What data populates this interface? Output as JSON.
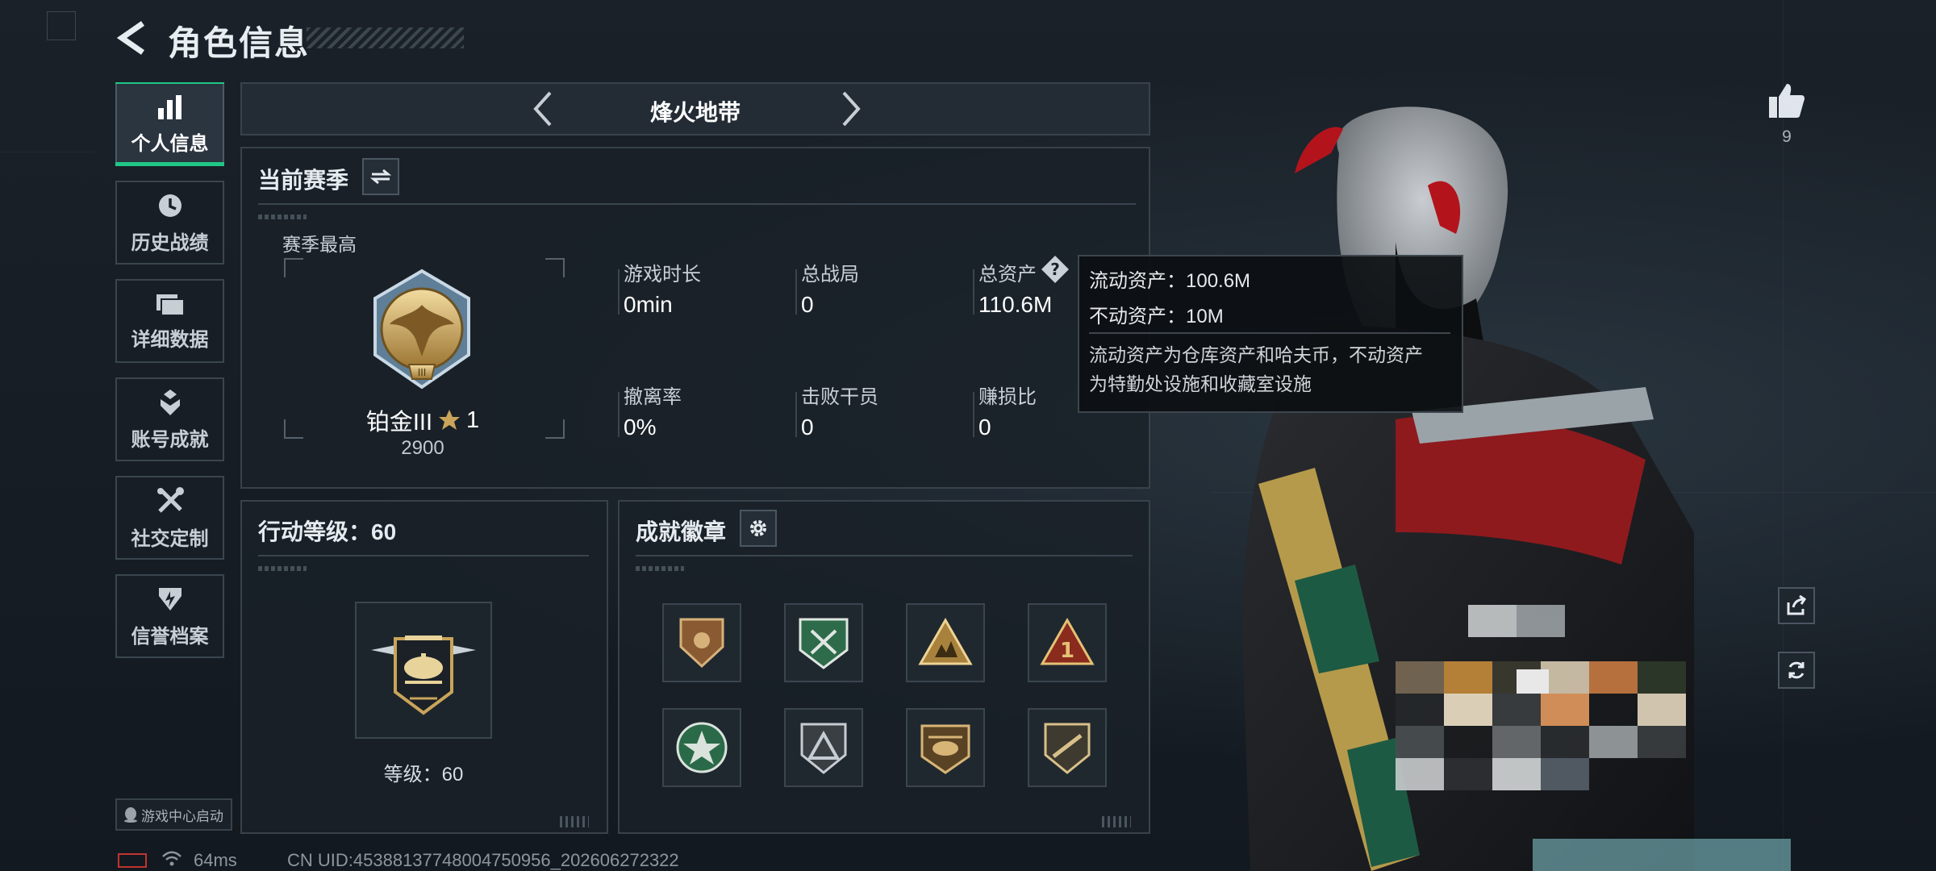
{
  "header": {
    "title": "角色信息"
  },
  "sidebar": {
    "items": [
      {
        "label": "个人信息",
        "icon": "bar-chart-icon",
        "active": true
      },
      {
        "label": "历史战绩",
        "icon": "history-clock-icon"
      },
      {
        "label": "详细数据",
        "icon": "folder-stack-icon"
      },
      {
        "label": "账号成就",
        "icon": "achievement-shield-icon"
      },
      {
        "label": "社交定制",
        "icon": "tools-icon"
      },
      {
        "label": "信誉档案",
        "icon": "reputation-badge-icon"
      }
    ],
    "launch_label": "游戏中心启动"
  },
  "mode": {
    "title": "烽火地带"
  },
  "season": {
    "title": "当前赛季",
    "best_label": "赛季最高",
    "rank_name": "铂金III",
    "rank_stars": "1",
    "rank_points": "2900",
    "stats": [
      {
        "label": "游戏时长",
        "value": "0min"
      },
      {
        "label": "总战局",
        "value": "0"
      },
      {
        "label": "总资产",
        "value": "110.6M"
      },
      {
        "label": "撤离率",
        "value": "0%"
      },
      {
        "label": "击败干员",
        "value": "0"
      },
      {
        "label": "赚损比",
        "value": "0"
      }
    ]
  },
  "tooltip": {
    "liquid": "流动资产：100.6M",
    "fixed": "不动资产：10M",
    "desc_line1": "流动资产为仓库资产和哈夫币，不动资产",
    "desc_line2": "为特勤处设施和收藏室设施"
  },
  "action_level": {
    "title": "行动等级：60",
    "level_label": "等级：60"
  },
  "achievements": {
    "title": "成就徽章"
  },
  "likes": {
    "count": "9"
  },
  "footer": {
    "ping": "64ms",
    "uid": "CN UID:45388137748004750956_202606272322"
  },
  "colors": {
    "accent": "#20c787",
    "gold": "#c9a45a",
    "panel_border": "#38424b"
  }
}
